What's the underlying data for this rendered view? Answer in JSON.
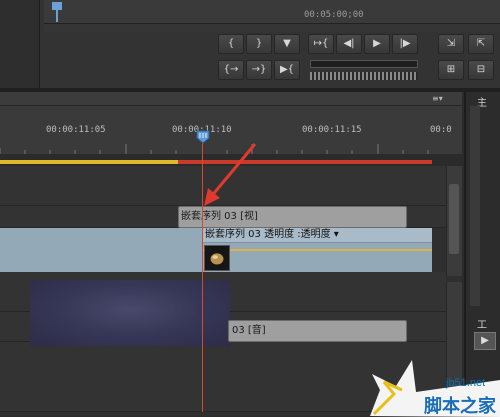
{
  "monitor": {
    "mini_ruler_timecode": "00:05:00;00"
  },
  "transport": {
    "row1": [
      "{",
      "}",
      "▼",
      "↦{",
      "◀|",
      "▶",
      "|▶",
      "}↤"
    ],
    "row2": [
      "{→",
      "→}",
      "▶{",
      "",
      "",
      "",
      "",
      ""
    ]
  },
  "timeline": {
    "panel_menu": "≡▾",
    "ruler_labels": [
      "00:00:11:05",
      "00:00:11:10",
      "00:00:11:15",
      "00:0"
    ]
  },
  "clips": {
    "video_title": "嵌套序列 03 [视]",
    "video_bar": "嵌套序列 03 透明度 :透明度 ▾",
    "audio_title": "03 [音]"
  },
  "right_panel": {
    "main_label": "主",
    "tools_label": "工",
    "tool_button": "▶"
  },
  "watermark": {
    "url": "jb51.net",
    "cn": "脚本之家"
  },
  "colors": {
    "playhead": "#d24b2e",
    "work_area": "#e0b92a",
    "clip_video": "#94a9b7",
    "annotation_arrow": "#e03a2e"
  }
}
